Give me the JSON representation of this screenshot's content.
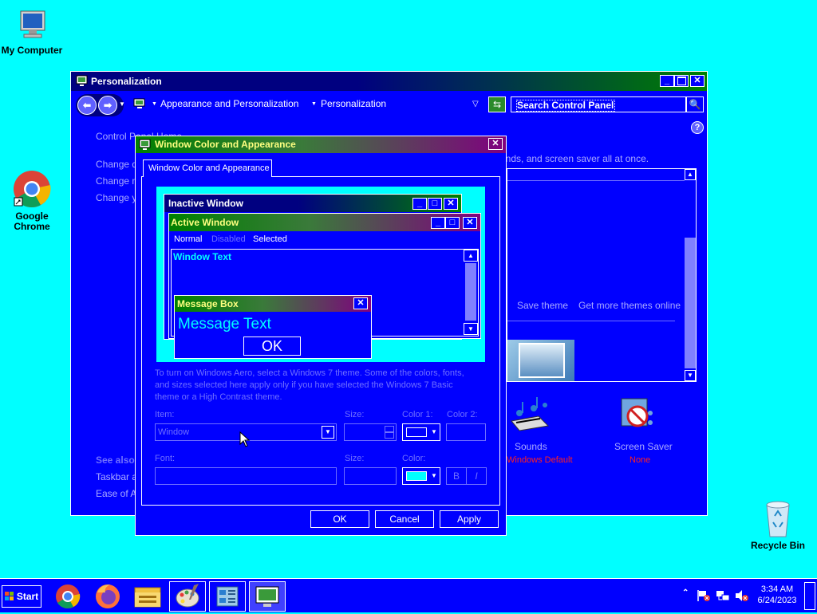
{
  "desktop": {
    "icons": [
      {
        "label": "My Computer"
      },
      {
        "label": "Google Chrome"
      },
      {
        "label": "Recycle Bin"
      }
    ]
  },
  "personalization": {
    "title": "Personalization",
    "breadcrumb": [
      "Appearance and Personalization",
      "Personalization"
    ],
    "search_placeholder": "Search Control Panel",
    "left_nav": [
      "Control Panel Home",
      "Change desktop icons",
      "Change mouse pointers",
      "Change your account picture"
    ],
    "see_also_title": "See also",
    "see_also": [
      "Taskbar and Start Menu",
      "Ease of Access Center"
    ],
    "theme_hint": "unds, and screen saver all at once.",
    "save_theme": "Save theme",
    "more_themes": "Get more themes online",
    "sounds_label": "Sounds",
    "sounds_sub": "Windows Default",
    "screensaver_label": "Screen Saver",
    "screensaver_sub": "None"
  },
  "dialog": {
    "title": "Window Color and Appearance",
    "tab": "Window Color and Appearance",
    "preview": {
      "inactive_title": "Inactive Window",
      "active_title": "Active Window",
      "menu_normal": "Normal",
      "menu_disabled": "Disabled",
      "menu_selected": "Selected",
      "window_text": "Window Text",
      "msgbox_title": "Message Box",
      "msgbox_text": "Message Text",
      "msgbox_ok": "OK"
    },
    "info_text": "To turn on Windows Aero, select a Windows 7 theme.  Some of the colors, fonts, and sizes selected here apply only if you have selected the Windows 7 Basic theme or a High Contrast theme.",
    "item_label": "Item:",
    "item_value": "Window",
    "size_label": "Size:",
    "color1_label": "Color 1:",
    "color2_label": "Color 2:",
    "font_label": "Font:",
    "size2_label": "Size:",
    "color_label": "Color:",
    "bold_label": "B",
    "italic_label": "I",
    "ok": "OK",
    "cancel": "Cancel",
    "apply": "Apply",
    "color1_value": "#0000ff",
    "color_value": "#00ffff"
  },
  "taskbar": {
    "start": "Start",
    "time": "3:34 AM",
    "date": "6/24/2023",
    "apps": [
      "chrome-icon",
      "firefox-icon",
      "file-explorer-icon",
      "paint-icon",
      "control-panel-icon",
      "display-icon"
    ]
  }
}
